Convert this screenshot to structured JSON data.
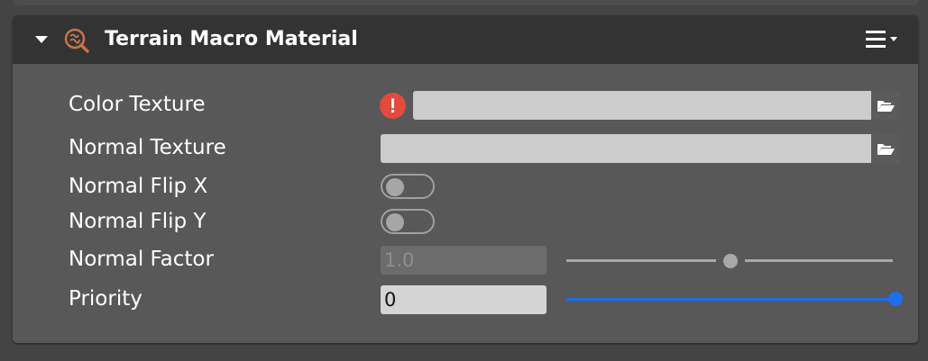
{
  "component": {
    "title": "Terrain Macro Material",
    "icon": "terrain-material-icon",
    "collapse_icon": "triangle-down-icon",
    "menu_icon": "hamburger-menu-icon"
  },
  "properties": {
    "color_texture": {
      "label": "Color Texture",
      "value": "",
      "warning_icon": "error-icon",
      "warning_glyph": "!",
      "browse_icon": "folder-open-icon"
    },
    "normal_texture": {
      "label": "Normal Texture",
      "value": "",
      "browse_icon": "folder-open-icon"
    },
    "normal_flip_x": {
      "label": "Normal Flip X",
      "state": "off"
    },
    "normal_flip_y": {
      "label": "Normal Flip Y",
      "state": "off"
    },
    "normal_factor": {
      "label": "Normal Factor",
      "value": "1.0",
      "disabled": true,
      "slider_fraction": 0.5
    },
    "priority": {
      "label": "Priority",
      "value": "0",
      "disabled": false,
      "slider_fraction": 1.0
    }
  },
  "colors": {
    "panel_bg": "#585858",
    "header_bg": "#333333",
    "warning": "#e14a3c",
    "slider_active": "#1e6ef0",
    "slider_inactive": "#a8a8a8",
    "icon_accent": "#c8734a"
  }
}
